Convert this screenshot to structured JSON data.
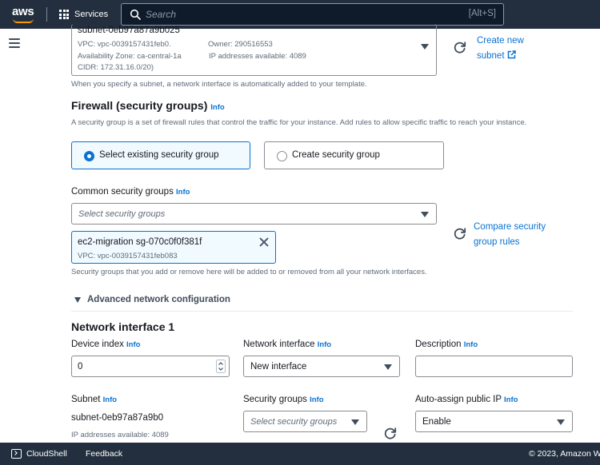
{
  "nav": {
    "brand": "aws",
    "services_label": "Services",
    "search_placeholder": "Search",
    "search_shortcut": "[Alt+S]"
  },
  "subnet_section": {
    "selected_title": "subnet-0eb97a87a9b025",
    "vpc": "VPC: vpc-0039157431feb0.",
    "owner": "Owner: 290516553",
    "availability_zone": "Availability Zone: ca-central-1a",
    "ip_available": "IP addresses available: 4089",
    "cidr": "CIDR: 172.31.16.0/20)",
    "create_new_line1": "Create new",
    "create_new_line2": "subnet",
    "help": "When you specify a subnet, a network interface is automatically added to your template."
  },
  "firewall": {
    "title": "Firewall (security groups)",
    "info": "Info",
    "description": "A security group is a set of firewall rules that control the traffic for your instance. Add rules to allow specific traffic to reach your instance.",
    "option_existing": "Select existing security group",
    "option_create": "Create security group",
    "selected_option": "existing",
    "common_label": "Common security groups",
    "common_info": "Info",
    "common_placeholder": "Select security groups",
    "token_name": "ec2-migration   sg-070c0f0f381f",
    "token_vpc": "VPC: vpc-0039157431feb083",
    "compare_line1": "Compare security",
    "compare_line2": "group rules",
    "help": "Security groups that you add or remove here will be added to or removed from all your network interfaces."
  },
  "advanced": {
    "label": "Advanced network configuration"
  },
  "network_interface": {
    "title": "Network interface 1",
    "device_index_label": "Device index",
    "device_index_info": "Info",
    "device_index_value": "0",
    "ni_label": "Network interface",
    "ni_info": "Info",
    "ni_value": "New interface",
    "description_label": "Description",
    "description_info": "Info",
    "description_value": "",
    "subnet_label": "Subnet",
    "subnet_info": "Info",
    "subnet_value": "subnet-0eb97a87a9b0",
    "subnet_ip": "IP addresses available: 4089",
    "sg_label": "Security groups",
    "sg_info": "Info",
    "sg_placeholder": "Select security groups",
    "public_ip_label": "Auto-assign public IP",
    "public_ip_info": "Info",
    "public_ip_value": "Enable"
  },
  "footer": {
    "cloudshell": "CloudShell",
    "feedback": "Feedback",
    "copyright": "© 2023, Amazon W"
  },
  "colors": {
    "nav_bg": "#232f3e",
    "link": "#0972d3",
    "accent_orange": "#ff9900",
    "selected_bg": "#f1faff"
  }
}
